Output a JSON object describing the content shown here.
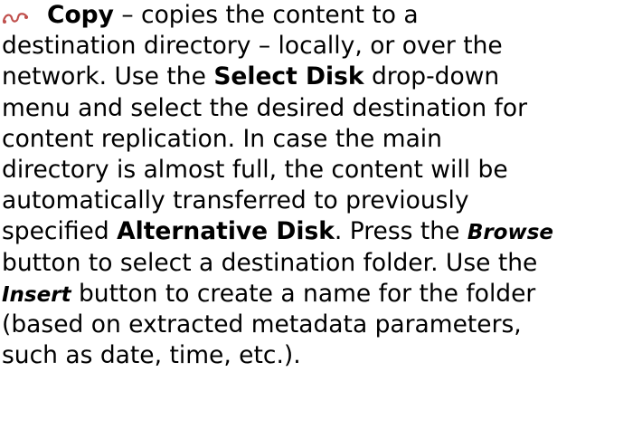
{
  "bullet_icon": "scroll-bullet-icon",
  "lines": [
    {
      "parts": [
        {
          "t": "Copy",
          "s": "b"
        },
        {
          "t": " – copies the content to a",
          "s": ""
        }
      ]
    },
    {
      "parts": [
        {
          "t": "destination directory – locally, or over the",
          "s": ""
        }
      ]
    },
    {
      "parts": [
        {
          "t": "network. Use the ",
          "s": ""
        },
        {
          "t": "Select Disk",
          "s": "b"
        },
        {
          "t": " drop-down",
          "s": ""
        }
      ]
    },
    {
      "parts": [
        {
          "t": "menu and select the desired destination for",
          "s": ""
        }
      ]
    },
    {
      "parts": [
        {
          "t": "content replication. In case the main",
          "s": ""
        }
      ]
    },
    {
      "parts": [
        {
          "t": "directory is almost full, the content will be",
          "s": ""
        }
      ]
    },
    {
      "parts": [
        {
          "t": "automatically transferred to previously",
          "s": ""
        }
      ]
    },
    {
      "parts": [
        {
          "t": "specified ",
          "s": ""
        },
        {
          "t": "Alternative Disk",
          "s": "b"
        },
        {
          "t": ". Press the ",
          "s": ""
        },
        {
          "t": "Browse",
          "s": "bi"
        }
      ]
    },
    {
      "parts": [
        {
          "t": "button to select a destination folder. Use the",
          "s": ""
        }
      ]
    },
    {
      "parts": [
        {
          "t": "Insert",
          "s": "bi"
        },
        {
          "t": " button to create a name for the folder",
          "s": ""
        }
      ]
    },
    {
      "parts": [
        {
          "t": "(based on extracted metadata parameters,",
          "s": ""
        }
      ]
    },
    {
      "parts": [
        {
          "t": "such as date, time, etc.).",
          "s": ""
        }
      ]
    }
  ]
}
